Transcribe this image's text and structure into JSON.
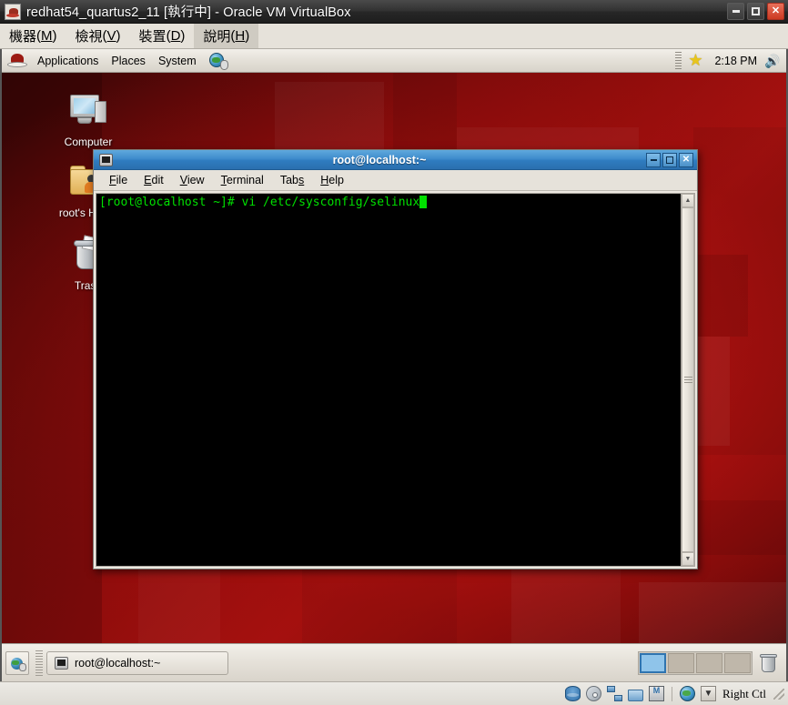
{
  "vbox": {
    "title": "redhat54_quartus2_11 [執行中] - Oracle VM VirtualBox",
    "title_icon": "redhat-fedora-icon",
    "window_buttons": {
      "minimize": "minimize-icon",
      "maximize": "maximize-icon",
      "close": "✕"
    },
    "menus": [
      {
        "label": "機器(M)",
        "text": "機器",
        "mnemonic": "M",
        "active": false
      },
      {
        "label": "檢視(V)",
        "text": "檢視",
        "mnemonic": "V",
        "active": false
      },
      {
        "label": "裝置(D)",
        "text": "裝置",
        "mnemonic": "D",
        "active": false
      },
      {
        "label": "說明(H)",
        "text": "說明",
        "mnemonic": "H",
        "active": true
      }
    ],
    "statusbar": {
      "icons": [
        "hard-disk-icon",
        "optical-disk-icon",
        "network-icon",
        "shared-folders-icon",
        "cpu-icon",
        "network-globe-icon",
        "host-key-icon"
      ],
      "host_key_label": "Right Ctl"
    }
  },
  "guest": {
    "top_panel": {
      "menu_icon": "redhat-logo-icon",
      "menus": [
        "Applications",
        "Places",
        "System"
      ],
      "launcher_icon": "web-browser-icon",
      "star_icon": "★",
      "clock": "2:18 PM",
      "volume_icon": "🔊"
    },
    "desktop_icons": [
      {
        "name": "Computer",
        "label": "Computer",
        "icon": "computer-icon"
      },
      {
        "name": "root's Home",
        "label": "root's Home",
        "icon": "home-folder-icon"
      },
      {
        "name": "Trash",
        "label": "Trash",
        "icon": "trash-icon"
      }
    ],
    "bottom_panel": {
      "show_desktop_icon": "show-desktop-icon",
      "taskbar_buttons": [
        {
          "label": "root@localhost:~",
          "icon": "terminal-icon",
          "active": true
        }
      ],
      "workspaces": [
        {
          "index": 1,
          "active": true
        },
        {
          "index": 2,
          "active": false
        },
        {
          "index": 3,
          "active": false
        },
        {
          "index": 4,
          "active": false
        }
      ],
      "trash_applet_icon": "trash-applet-icon"
    }
  },
  "terminal": {
    "title": "root@localhost:~",
    "title_icon": "terminal-icon",
    "window_buttons": {
      "minimize": "minimize-icon",
      "maximize": "maximize-icon",
      "close": "✕"
    },
    "menus": [
      {
        "label": "File",
        "pre": "",
        "mnemonic": "F",
        "post": "ile"
      },
      {
        "label": "Edit",
        "pre": "",
        "mnemonic": "E",
        "post": "dit"
      },
      {
        "label": "View",
        "pre": "",
        "mnemonic": "V",
        "post": "iew"
      },
      {
        "label": "Terminal",
        "pre": "",
        "mnemonic": "T",
        "post": "erminal"
      },
      {
        "label": "Tabs",
        "pre": "Tab",
        "mnemonic": "s",
        "post": ""
      },
      {
        "label": "Help",
        "pre": "",
        "mnemonic": "H",
        "post": "elp"
      }
    ],
    "content": {
      "prompt": "[root@localhost ~]# ",
      "command": "vi /etc/sysconfig/selinux",
      "full_line": "[root@localhost ~]# vi /etc/sysconfig/selinux",
      "text_color": "#00e000",
      "background": "#000000",
      "cursor": "block"
    },
    "scrollbar": {
      "up_arrow": "▲",
      "down_arrow": "▼"
    }
  }
}
